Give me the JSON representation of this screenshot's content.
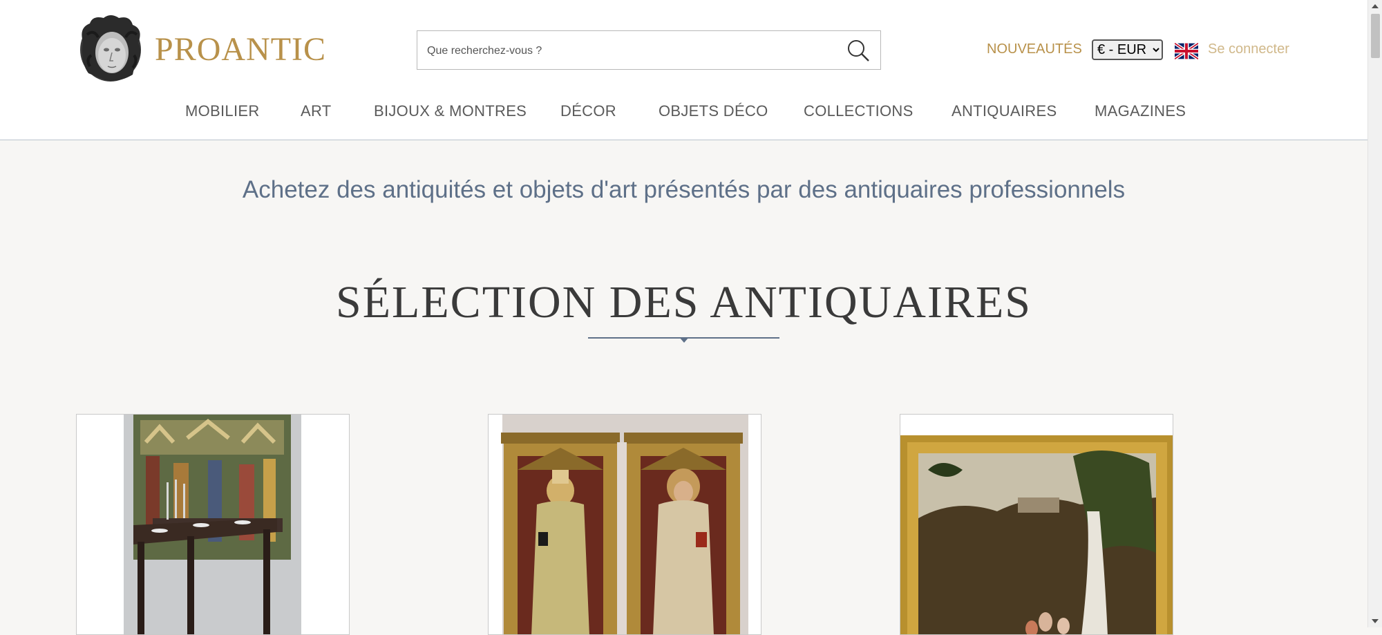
{
  "header": {
    "brand": "PROANTIC",
    "search_placeholder": "Que recherchez-vous ?",
    "new_items_label": "NOUVEAUTÉS",
    "currency_selected": "€ - EUR",
    "login_label": "Se connecter"
  },
  "nav": {
    "items": [
      {
        "label": "MOBILIER"
      },
      {
        "label": "ART"
      },
      {
        "label": "BIJOUX & MONTRES"
      },
      {
        "label": "DÉCOR"
      },
      {
        "label": "OBJETS DÉCO"
      },
      {
        "label": "COLLECTIONS"
      },
      {
        "label": "ANTIQUAIRES"
      },
      {
        "label": "MAGAZINES"
      }
    ]
  },
  "main": {
    "tagline": "Achetez des antiquités et objets d'art présentés par des antiquaires professionnels",
    "section_title": "SÉLECTION DES ANTIQUAIRES"
  },
  "icons": {
    "search": "search-icon",
    "flag": "uk-flag-icon",
    "logo": "medusa-head-logo"
  },
  "colors": {
    "brand_gold": "#b8914a",
    "tagline_blue": "#5e7088",
    "background": "#f7f6f4"
  }
}
